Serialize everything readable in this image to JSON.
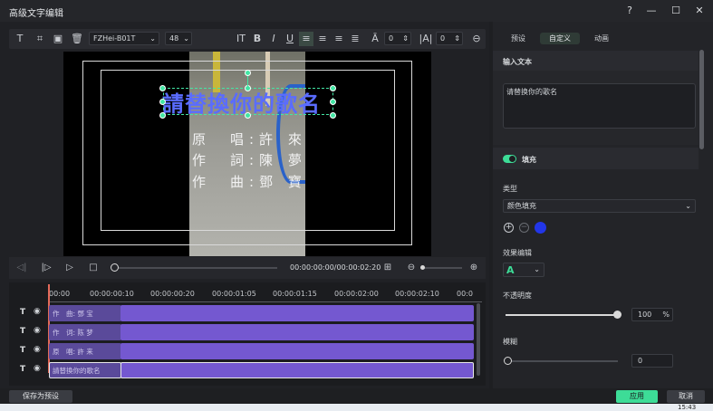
{
  "window": {
    "title": "高级文字编辑",
    "help": "?",
    "minimize": "—",
    "maximize": "☐",
    "close": "✕"
  },
  "toolbar": {
    "font": "FZHei-B01T",
    "size": "48",
    "char_spacing": "0",
    "line_spacing": "0"
  },
  "canvas": {
    "title_text": "請替換你的歌名",
    "credits": [
      "原　唱:許 來",
      "作　詞:陳 夢",
      "作　曲:鄧 寶"
    ]
  },
  "player": {
    "timecode": "00:00:00:00/00:00:02:20"
  },
  "timeline": {
    "ruler": [
      "00:00",
      "00:00:00:10",
      "00:00:00:20",
      "00:00:01:05",
      "00:00:01:15",
      "00:00:02:00",
      "00:00:02:10",
      "00:0"
    ],
    "tracks": [
      {
        "label": "作　曲: 鄧 宝"
      },
      {
        "label": "作　词: 陈 梦"
      },
      {
        "label": "原　唱: 許 来"
      },
      {
        "label": "請替換你的歌名"
      }
    ],
    "track_icon": "T"
  },
  "buttons": {
    "save_preset": "保存为预设",
    "apply": "应用",
    "cancel": "取消"
  },
  "panel": {
    "tabs": [
      "预设",
      "自定义",
      "动画"
    ],
    "active_tab": "自定义",
    "input_section": "输入文本",
    "input_value": "请替换你的歌名",
    "fill_label": "填充",
    "type_label": "类型",
    "type_value": "颜色填充",
    "effect_label": "效果编辑",
    "effect_value": "A",
    "opacity_label": "不透明度",
    "opacity_value": "100",
    "opacity_unit": "%",
    "blur_label": "模糊",
    "blur_value": "0"
  },
  "colors": {
    "accent": "#3ddc97",
    "fill_color": "#2236e8",
    "title_color": "#5a6cff",
    "clip_color": "#7458d0"
  },
  "taskbar": {
    "clock": "15:43"
  }
}
